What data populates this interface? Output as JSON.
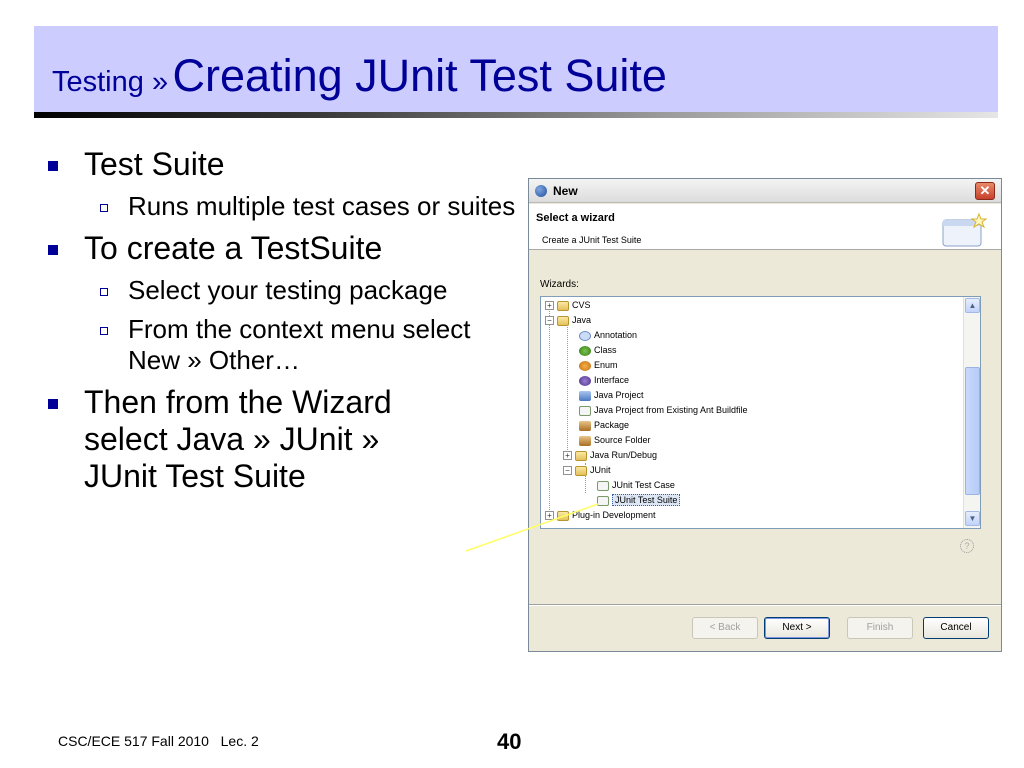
{
  "title": {
    "prefix": "Testing »",
    "main": "Creating JUnit Test Suite"
  },
  "bullets": [
    {
      "level": 1,
      "text": "Test Suite"
    },
    {
      "level": 2,
      "text": "Runs multiple test cases or suites"
    },
    {
      "level": 1,
      "text": "To create a TestSuite"
    },
    {
      "level": 2,
      "text": "Select your testing package"
    },
    {
      "level": 2,
      "text": "From the context menu select New » Other…"
    },
    {
      "level": 1,
      "text": "Then from the Wizard select Java » JUnit » JUnit Test Suite"
    }
  ],
  "dialog": {
    "title": "New",
    "close": "✕",
    "header_title": "Select a wizard",
    "header_subtitle": "Create a JUnit Test Suite",
    "wizards_label": "Wizards:",
    "tree": {
      "cvs": "CVS",
      "java": "Java",
      "annotation": "Annotation",
      "class": "Class",
      "enum": "Enum",
      "interface": "Interface",
      "java_project": "Java Project",
      "java_project_ant": "Java Project from Existing Ant Buildfile",
      "package": "Package",
      "source_folder": "Source Folder",
      "java_run_debug": "Java Run/Debug",
      "junit": "JUnit",
      "junit_test_case": "JUnit Test Case",
      "junit_test_suite": "JUnit Test Suite",
      "plugin_dev": "Plug-in Development"
    },
    "buttons": {
      "back": "< Back",
      "next": "Next >",
      "finish": "Finish",
      "cancel": "Cancel"
    }
  },
  "footer": {
    "course": "CSC/ECE 517 Fall 2010   Lec. 2",
    "page": "40"
  },
  "colors": {
    "title_band": "#ccccff",
    "title_text": "#000099",
    "bullet_marker": "#000099",
    "connector": "#ffff66"
  }
}
